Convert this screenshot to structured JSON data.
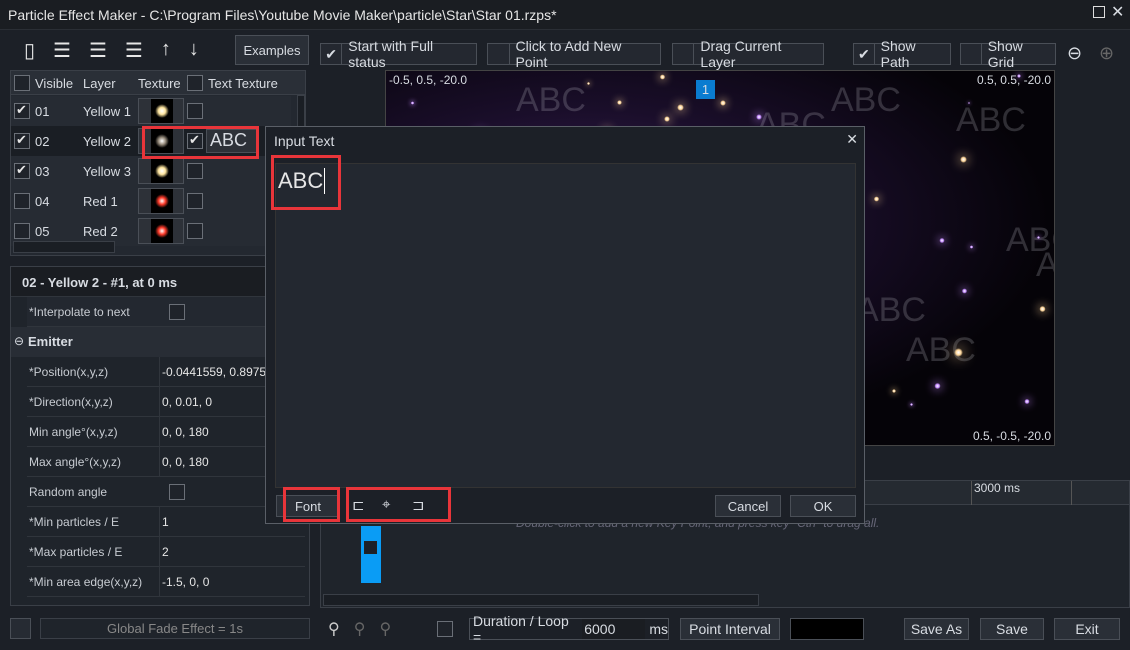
{
  "window": {
    "title": "Particle Effect Maker - C:\\Program Files\\Youtube Movie Maker\\particle\\Star\\Star 01.rzps*"
  },
  "toolbar": {
    "examples_label": "Examples",
    "icons": [
      "open-icon",
      "add-layer-icon",
      "delete-layer-icon",
      "delete-all-layers-icon",
      "move-up-icon",
      "move-down-icon"
    ]
  },
  "options": [
    {
      "label": "Start with Full status",
      "checked": true
    },
    {
      "label": "Click to Add New Point",
      "checked": false
    },
    {
      "label": "Drag Current Layer",
      "checked": false
    },
    {
      "label": "Show Path",
      "checked": true
    },
    {
      "label": "Show Grid",
      "checked": false
    }
  ],
  "layers": {
    "headers": [
      "Visible",
      "Layer",
      "Texture",
      "Text Texture"
    ],
    "rows": [
      {
        "id": "01",
        "name": "Yellow 1",
        "visible": true,
        "text": false,
        "color": "#ffe6a0"
      },
      {
        "id": "02",
        "name": "Yellow 2",
        "visible": true,
        "text": true,
        "text_value": "ABC",
        "color": "#9a8f80"
      },
      {
        "id": "03",
        "name": "Yellow 3",
        "visible": true,
        "text": false,
        "color": "#ffe6a0"
      },
      {
        "id": "04",
        "name": "Red 1",
        "visible": false,
        "text": false,
        "color": "#ff3b2a"
      },
      {
        "id": "05",
        "name": "Red 2",
        "visible": false,
        "text": false,
        "color": "#ff3b2a"
      }
    ]
  },
  "properties": {
    "title": "02 - Yellow 2 - #1, at 0 ms",
    "interpolate": "*Interpolate to next",
    "section": "Emitter",
    "rows": [
      {
        "k": "*Position(x,y,z)",
        "v": "-0.0441559, 0.8975"
      },
      {
        "k": "*Direction(x,y,z)",
        "v": "0, 0.01, 0"
      },
      {
        "k": "Min angle°(x,y,z)",
        "v": "0, 0, 180"
      },
      {
        "k": "Max angle°(x,y,z)",
        "v": "0, 0, 180"
      },
      {
        "k": "Random angle",
        "v": ""
      },
      {
        "k": "*Min particles / E",
        "v": "1"
      },
      {
        "k": "*Max particles / E",
        "v": "2"
      },
      {
        "k": "*Min area edge(x,y,z)",
        "v": "-1.5, 0, 0"
      }
    ]
  },
  "preview": {
    "tl": "-0.5, 0.5, -20.0",
    "tr": "0.5, 0.5, -20.0",
    "br": "0.5, -0.5, -20.0",
    "badge": "1",
    "abc": "ABC"
  },
  "dialog": {
    "title": "Input Text",
    "value": "ABC",
    "font": "Font",
    "cancel": "Cancel",
    "ok": "OK"
  },
  "timeline": {
    "tick": "3000 ms",
    "hint": "Double-click to add a new Key Point, and press key \"Ctrl\" to drag all."
  },
  "bottom": {
    "fade": "Global Fade Effect = 1s",
    "duration_label": "Duration / Loop =",
    "duration": "6000",
    "unit": "ms",
    "interval": "Point Interval",
    "save_as": "Save As",
    "save": "Save",
    "exit": "Exit"
  }
}
